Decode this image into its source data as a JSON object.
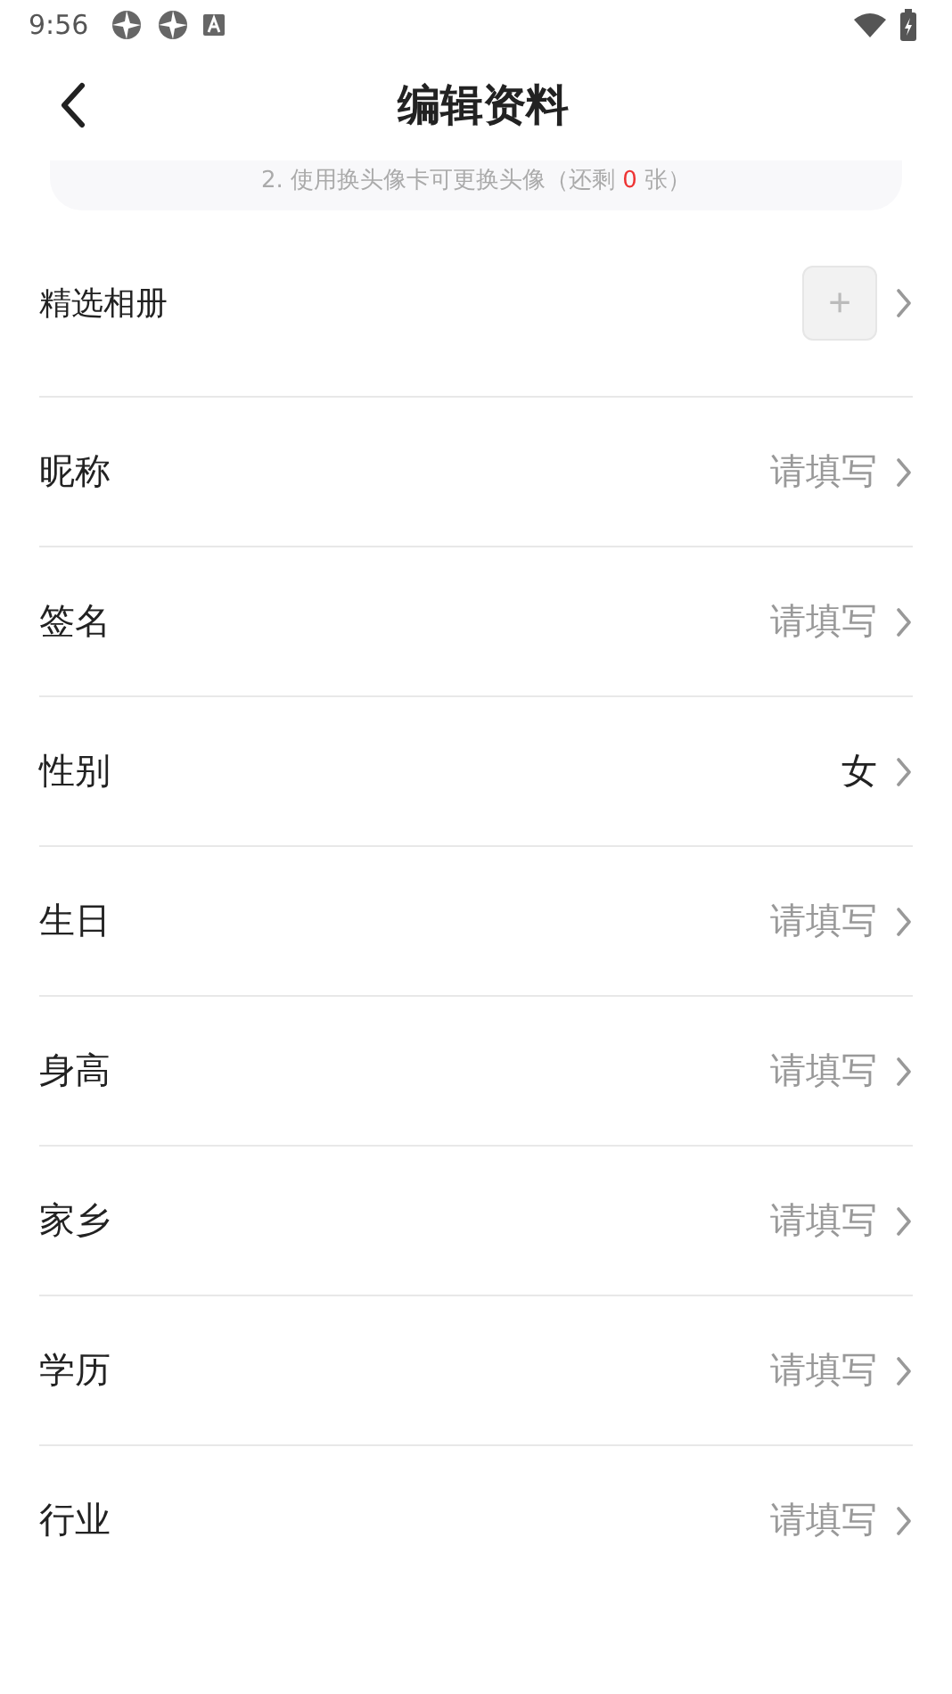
{
  "status_bar": {
    "time": "9:56"
  },
  "header": {
    "title": "编辑资料"
  },
  "note": {
    "prefix": "2. 使用换头像卡可更换头像（还剩 ",
    "count": "0",
    "suffix": " 张）"
  },
  "rows": [
    {
      "kind": "album",
      "label": "精选相册",
      "add": "+"
    },
    {
      "kind": "field",
      "label": "昵称",
      "placeholder": "请填写"
    },
    {
      "kind": "field",
      "label": "签名",
      "placeholder": "请填写"
    },
    {
      "kind": "field",
      "label": "性别",
      "value": "女"
    },
    {
      "kind": "field",
      "label": "生日",
      "placeholder": "请填写"
    },
    {
      "kind": "field",
      "label": "身高",
      "placeholder": "请填写"
    },
    {
      "kind": "field",
      "label": "家乡",
      "placeholder": "请填写"
    },
    {
      "kind": "field",
      "label": "学历",
      "placeholder": "请填写"
    },
    {
      "kind": "field",
      "label": "行业",
      "placeholder": "请填写"
    }
  ]
}
